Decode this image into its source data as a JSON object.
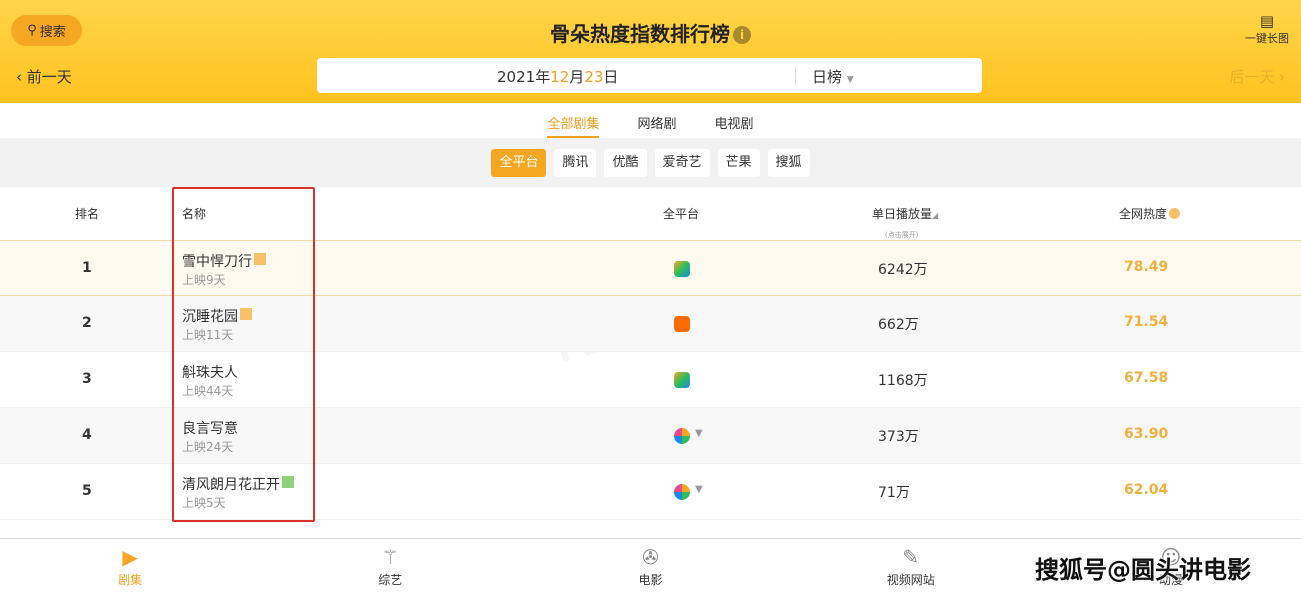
{
  "header": {
    "search_label": "搜索",
    "title": "骨朵热度指数排行榜",
    "long_image_label": "一键长图",
    "prev_label": "前一天",
    "next_label": "后一天",
    "date": {
      "year": "2021",
      "year_unit": "年",
      "month": "12",
      "month_unit": "月",
      "day": "23",
      "day_unit": "日"
    },
    "period": "日榜"
  },
  "tabs": [
    {
      "label": "全部剧集",
      "active": true
    },
    {
      "label": "网络剧"
    },
    {
      "label": "电视剧"
    }
  ],
  "filters": [
    {
      "label": "全平台",
      "active": true
    },
    {
      "label": "腾讯"
    },
    {
      "label": "优酷"
    },
    {
      "label": "爱奇艺"
    },
    {
      "label": "芒果"
    },
    {
      "label": "搜狐"
    }
  ],
  "table": {
    "headers": {
      "rank": "排名",
      "name": "名称",
      "platform": "全平台",
      "views": "单日播放量",
      "views_sub": "(点击展开)",
      "heat": "全网热度"
    },
    "rows": [
      {
        "rank": "1",
        "name": "雪中悍刀行",
        "days": "上映9天",
        "platform": "tencent",
        "views": "6242万",
        "heat": "78.49"
      },
      {
        "rank": "2",
        "name": "沉睡花园",
        "days": "上映11天",
        "platform": "mango",
        "views": "662万",
        "heat": "71.54"
      },
      {
        "rank": "3",
        "name": "斛珠夫人",
        "days": "上映44天",
        "platform": "tencent",
        "views": "1168万",
        "heat": "67.58"
      },
      {
        "rank": "4",
        "name": "良言写意",
        "days": "上映24天",
        "platform": "multi",
        "views": "373万",
        "heat": "63.90"
      },
      {
        "rank": "5",
        "name": "清风朗月花正开",
        "days": "上映5天",
        "platform": "multi",
        "views": "71万",
        "heat": "62.04"
      }
    ]
  },
  "bottom_nav": [
    {
      "label": "剧集",
      "active": true
    },
    {
      "label": "综艺"
    },
    {
      "label": "电影"
    },
    {
      "label": "视频网站"
    },
    {
      "label": "动漫"
    }
  ],
  "watermark": "搜狐号@圆头讲电影",
  "background_watermark": "骨朵数据",
  "colors": {
    "accent": "#f5a623",
    "header": "#ffc21f",
    "highlight_box": "#d9302c"
  }
}
